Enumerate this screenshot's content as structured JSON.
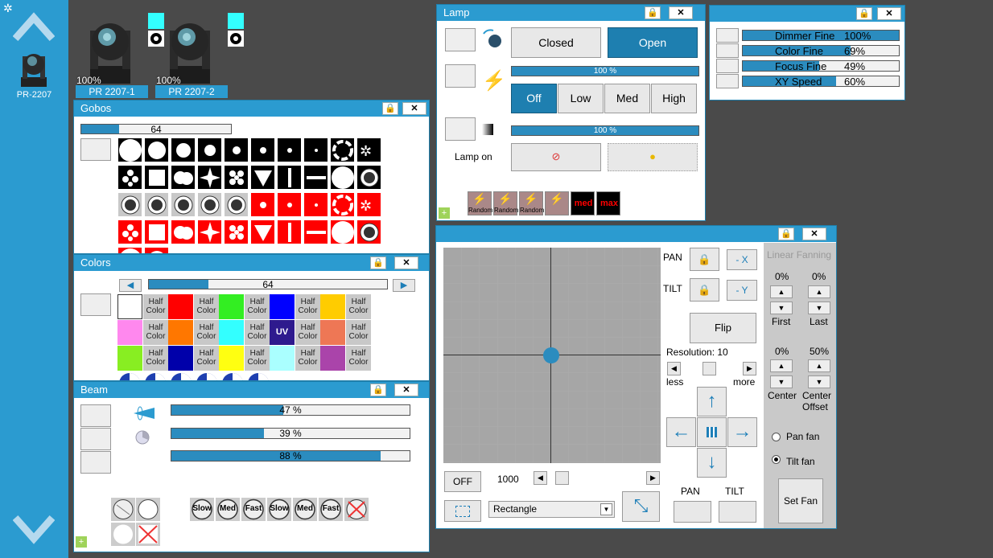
{
  "sidebar": {
    "fixture_label": "PR-2207"
  },
  "fixtures": [
    {
      "label": "PR 2207-1",
      "percent": "100%"
    },
    {
      "label": "PR 2207-2",
      "percent": "100%"
    }
  ],
  "gobos": {
    "title": "Gobos",
    "slider_value": "64",
    "slider_fraction": 0.25
  },
  "colors": {
    "title": "Colors",
    "slider_value": "64",
    "slider_fraction": 0.25,
    "half_label_1": "Half",
    "half_label_2": "Color",
    "swatches": [
      "#ffffff",
      "#ff0000",
      "#33ee22",
      "#0000ff",
      "#ffcc00",
      "#ff88ee",
      "#ff7700",
      "#33ffff",
      "#2e1a8e",
      "#ee7755",
      "#88ee22",
      "#0000aa",
      "#ffff11",
      "#aaffff",
      "#aa44aa"
    ],
    "uv_label": "UV"
  },
  "beam": {
    "title": "Beam",
    "bars": [
      {
        "text": "47 %",
        "fraction": 0.47
      },
      {
        "text": "39 %",
        "fraction": 0.39
      },
      {
        "text": "88 %",
        "fraction": 0.88
      }
    ],
    "speed_labels": [
      "Slow",
      "Med",
      "Fast",
      "Slow",
      "Med",
      "Fast"
    ]
  },
  "lamp": {
    "title": "Lamp",
    "closed_label": "Closed",
    "open_label": "Open",
    "bar1_text": "100 %",
    "bar2_text": "100 %",
    "power_labels": [
      "Off",
      "Low",
      "Med",
      "High"
    ],
    "lamp_on_label": "Lamp on",
    "macro_labels": [
      "Random",
      "Random",
      "Random",
      "",
      "med",
      "max"
    ]
  },
  "fine": {
    "rows": [
      {
        "label": "Dimmer Fine",
        "value": "100%",
        "fraction": 1.0
      },
      {
        "label": "Color Fine",
        "value": "69%",
        "fraction": 0.69
      },
      {
        "label": "Focus Fine",
        "value": "49%",
        "fraction": 0.49
      },
      {
        "label": "XY Speed",
        "value": "60%",
        "fraction": 0.6
      }
    ]
  },
  "position": {
    "pan_label": "PAN",
    "tilt_label": "TILT",
    "minus_x": "- X",
    "minus_y": "- Y",
    "flip_label": "Flip",
    "resolution_label": "Resolution: 10",
    "less_label": "less",
    "more_label": "more",
    "off_label": "OFF",
    "speed_value": "1000",
    "shape_select": "Rectangle",
    "pan_bottom_label": "PAN",
    "tilt_bottom_label": "TILT",
    "fanning_title": "Linear Fanning",
    "first_pct": "0%",
    "last_pct": "0%",
    "first_label": "First",
    "last_label": "Last",
    "center_pct": "0%",
    "offset_pct": "50%",
    "center_label": "Center",
    "offset_label": "Center Offset",
    "pan_fan_label": "Pan fan",
    "tilt_fan_label": "Tilt fan",
    "set_fan_label": "Set Fan"
  }
}
